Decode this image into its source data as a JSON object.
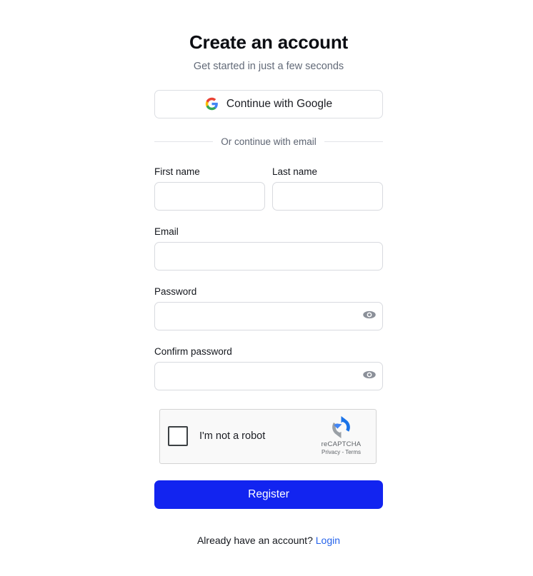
{
  "header": {
    "title": "Create an account",
    "subtitle": "Get started in just a few seconds"
  },
  "oauth": {
    "google_label": "Continue with Google",
    "google_icon": "google-g-icon"
  },
  "divider": {
    "text": "Or continue with email"
  },
  "form": {
    "first_name": {
      "label": "First name",
      "value": "",
      "placeholder": ""
    },
    "last_name": {
      "label": "Last name",
      "value": "",
      "placeholder": ""
    },
    "email": {
      "label": "Email",
      "value": "",
      "placeholder": ""
    },
    "password": {
      "label": "Password",
      "value": "",
      "placeholder": "",
      "toggle_icon": "eye-icon"
    },
    "confirm_password": {
      "label": "Confirm password",
      "value": "",
      "placeholder": "",
      "toggle_icon": "eye-icon"
    }
  },
  "recaptcha": {
    "checkbox_label": "I'm not a robot",
    "checked": false,
    "brand_name": "reCAPTCHA",
    "links": "Privacy - Terms",
    "logo_icon": "recaptcha-logo-icon"
  },
  "submit": {
    "label": "Register"
  },
  "footer": {
    "prompt": "Already have an account?",
    "link_label": "Login"
  },
  "colors": {
    "primary": "#1224f0",
    "link": "#2563eb",
    "border": "#d8dadf",
    "muted_text": "#626a78",
    "recaptcha_bg": "#f9f9f9"
  }
}
